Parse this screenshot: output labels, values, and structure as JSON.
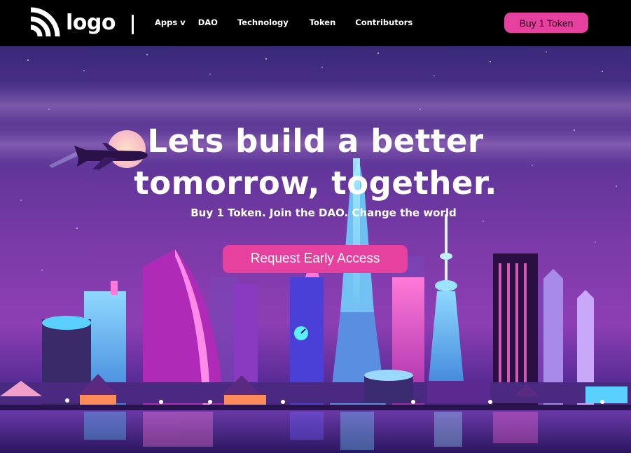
{
  "header": {
    "logo_text": "logo",
    "nav": {
      "apps": "Apps v",
      "dao": "DAO",
      "technology": "Technology",
      "token": "Token",
      "contributors": "Contributors"
    },
    "buy_button": "Buy 1 Token"
  },
  "hero": {
    "title_line1": "Lets build a better",
    "title_line2": "tomorrow, together.",
    "subtitle": "Buy 1 Token. Join the DAO. Change the world",
    "cta": "Request Early Access"
  },
  "colors": {
    "accent": "#e6419e",
    "nav_bg": "#000000",
    "hero_sky_top": "#3a2a78",
    "hero_sky_glow": "#8d3fb4"
  },
  "icons": {
    "logo": "rss-feed-icon"
  },
  "illustration": {
    "subject": "neon-city-skyline-at-night",
    "elements": [
      "moon",
      "airplane",
      "tv-tower",
      "clock-tower",
      "skyscrapers",
      "water-reflection"
    ]
  }
}
